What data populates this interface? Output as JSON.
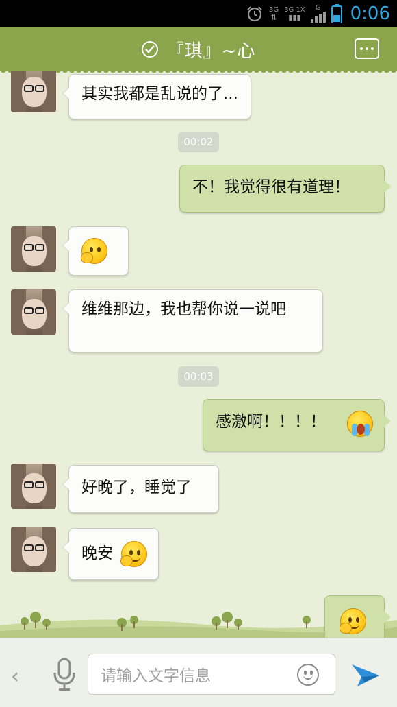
{
  "status_bar": {
    "net_top_left": "3G",
    "net_top_mid": "3G 1X",
    "net_top_right": "G",
    "clock": "0:06"
  },
  "header": {
    "title": "『琪』~心"
  },
  "messages": [
    {
      "side": "left",
      "type": "text",
      "text": "其实我都是乱说的了..."
    },
    {
      "type": "timestamp",
      "text": "00:02"
    },
    {
      "side": "right",
      "type": "text",
      "text": "不！我觉得很有道理！"
    },
    {
      "side": "left",
      "type": "emoji",
      "icon": "shy-face-emoji"
    },
    {
      "side": "left",
      "type": "text",
      "text": "维维那边，我也帮你说一说吧"
    },
    {
      "type": "timestamp",
      "text": "00:03"
    },
    {
      "side": "right",
      "type": "text+emoji",
      "text": "感激啊！！！！",
      "icon": "crying-face-emoji"
    },
    {
      "side": "left",
      "type": "text",
      "text": "好晚了，睡觉了"
    },
    {
      "side": "left",
      "type": "text+emoji",
      "text": "晚安",
      "icon": "thinking-face-emoji"
    },
    {
      "side": "right",
      "type": "emoji",
      "icon": "thinking-face-emoji"
    }
  ],
  "input_bar": {
    "placeholder": "请输入文字信息"
  },
  "colors": {
    "header": "#8aa54c",
    "chat_bg": "#e9efd9",
    "bubble_right": "#cfe1a8",
    "bubble_left": "#fcfcfa",
    "clock": "#2ea8e0",
    "send": "#2f8fd6"
  }
}
